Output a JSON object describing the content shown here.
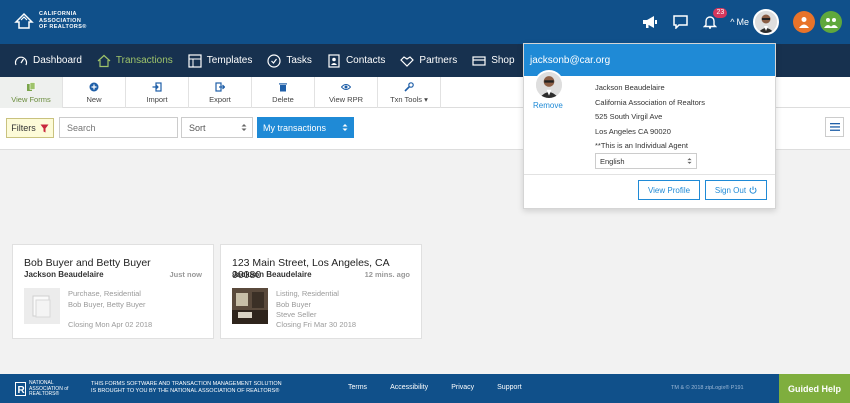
{
  "header": {
    "logo_lines": [
      "CALIFORNIA",
      "ASSOCIATION",
      "OF REALTORS®"
    ],
    "notification_count": "23",
    "me_label": "Me"
  },
  "nav": {
    "items": [
      {
        "label": "Dashboard",
        "icon": "gauge-icon"
      },
      {
        "label": "Transactions",
        "icon": "house-icon",
        "active": true
      },
      {
        "label": "Templates",
        "icon": "grid-icon"
      },
      {
        "label": "Tasks",
        "icon": "check-circle-icon"
      },
      {
        "label": "Contacts",
        "icon": "address-book-icon"
      },
      {
        "label": "Partners",
        "icon": "handshake-icon"
      },
      {
        "label": "Shop",
        "icon": "card-icon"
      }
    ]
  },
  "toolbar": {
    "items": [
      {
        "label": "View Forms",
        "icon": "docs-icon"
      },
      {
        "label": "New",
        "icon": "plus-circle-icon"
      },
      {
        "label": "Import",
        "icon": "import-icon"
      },
      {
        "label": "Export",
        "icon": "export-icon"
      },
      {
        "label": "Delete",
        "icon": "trash-icon"
      },
      {
        "label": "View RPR",
        "icon": "eye-icon"
      },
      {
        "label": "Txn Tools ▾",
        "icon": "wrench-icon"
      }
    ]
  },
  "filters": {
    "filter_label": "Filters",
    "search_placeholder": "Search",
    "sort_label": "Sort",
    "scope_label": "My transactions"
  },
  "cards": [
    {
      "title": "Bob Buyer and Betty Buyer",
      "agent": "Jackson Beaudelaire",
      "time": "Just now",
      "details": [
        "Purchase, Residential",
        "Bob Buyer, Betty Buyer"
      ],
      "closing": "Closing Mon Apr 02 2018"
    },
    {
      "title": "123 Main Street, Los Angeles, CA 90080",
      "agent": "Jackson Beaudelaire",
      "time": "12 mins. ago",
      "details": [
        "Listing, Residential",
        "Bob Buyer",
        "Steve Seller"
      ],
      "closing": "Closing Fri Mar 30 2018"
    }
  ],
  "profile_dropdown": {
    "email": "jacksonb@car.org",
    "remove_label": "Remove",
    "name": "Jackson Beaudelaire",
    "organization": "California Association of Realtors",
    "address1": "525 South Virgil Ave",
    "address2": "Los Angeles CA 90020",
    "note": "**This is an Individual Agent",
    "language": "English",
    "view_profile": "View Profile",
    "sign_out": "Sign Out"
  },
  "footer": {
    "nar_lines": [
      "NATIONAL",
      "ASSOCIATION of",
      "REALTORS®"
    ],
    "copy_line1": "THIS FORMS SOFTWARE AND TRANSACTION MANAGEMENT SOLUTION",
    "copy_line2": "IS BROUGHT TO YOU BY THE NATIONAL ASSOCIATION OF REALTORS®",
    "links": [
      "Terms",
      "Accessibility",
      "Privacy",
      "Support"
    ],
    "trademark": "TM & © 2018 zipLogix® P191",
    "guided_help": "Guided Help"
  },
  "colors": {
    "header_bg": "#10508a",
    "nav_bg": "#17314f",
    "accent_blue": "#1f8ad6",
    "accent_green": "#7fae3e"
  }
}
